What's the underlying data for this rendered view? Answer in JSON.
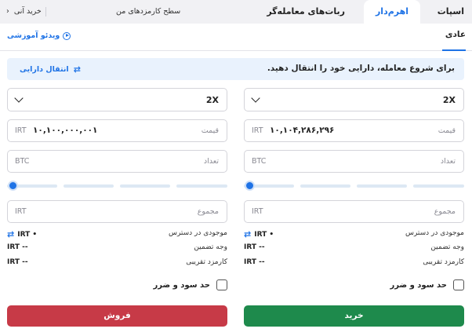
{
  "header": {
    "tabs": [
      {
        "label": "اسپات"
      },
      {
        "label": "اهرم‌دار"
      },
      {
        "label": "ربات‌های معامله‌گر"
      }
    ],
    "fee_link": "سطح کارمزدهای من",
    "instant_buy": "خرید آنی",
    "instant_buy_chevron": "‹"
  },
  "subheader": {
    "mode": "عادی",
    "video_link": "ویدئو آموزشی"
  },
  "banner": {
    "text": "برای شروع معامله، دارایی خود را انتقال دهید.",
    "transfer_link": "انتقال دارایی"
  },
  "buy": {
    "leverage": "2X",
    "price_label": "قیمت",
    "price_unit": "IRT",
    "price_value": "۱۰,۱۰۴,۲۸۶,۲۹۶",
    "amount_label": "تعداد",
    "amount_unit": "BTC",
    "total_label": "مجموع",
    "total_unit": "IRT",
    "available_label": "موجودی در دسترس",
    "available_value": "IRT •",
    "margin_label": "وجه تضمین",
    "margin_value": "IRT --",
    "fee_label": "کارمزد تقریبی",
    "fee_value": "IRT --",
    "tp_sl_label": "حد سود و ضرر",
    "button": "خرید"
  },
  "sell": {
    "leverage": "2X",
    "price_label": "قیمت",
    "price_unit": "IRT",
    "price_value": "۱۰,۱۰۰,۰۰۰,۰۰۱",
    "amount_label": "تعداد",
    "amount_unit": "BTC",
    "total_label": "مجموع",
    "total_unit": "IRT",
    "available_label": "موجودی در دسترس",
    "available_value": "IRT •",
    "margin_label": "وجه تضمین",
    "margin_value": "IRT --",
    "fee_label": "کارمزد تقریبی",
    "fee_value": "IRT --",
    "tp_sl_label": "حد سود و ضرر",
    "button": "فروش"
  },
  "icons": {
    "swap": "⇄",
    "chevron_down": "chevron-down-icon",
    "play": "play-circle-icon"
  },
  "colors": {
    "accent": "#1f73e6",
    "buy": "#1e8a4c",
    "sell": "#c73a47",
    "banner_bg": "#e9f2fd"
  }
}
